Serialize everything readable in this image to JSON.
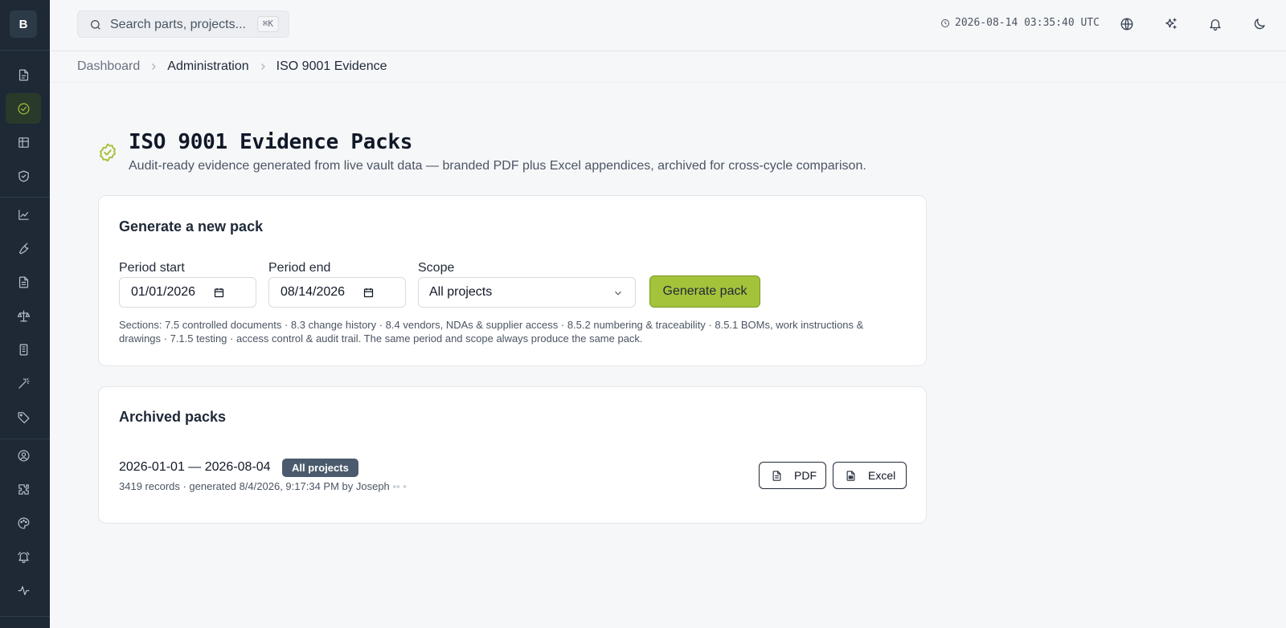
{
  "app": {
    "brand_letter": "B"
  },
  "topbar": {
    "search_placeholder": "Search parts, projects...",
    "search_shortcut": "⌘K",
    "clock": "2026-08-14 03:35:40 UTC"
  },
  "breadcrumb": [
    "Dashboard",
    "Administration",
    "ISO 9001 Evidence"
  ],
  "page": {
    "title": "ISO 9001 Evidence Packs",
    "subtitle": "Audit-ready evidence generated from live vault data — branded PDF plus Excel appendices, archived for cross-cycle comparison."
  },
  "generate": {
    "title": "Generate a new pack",
    "period_start_label": "Period start",
    "period_start_value": "01/01/2026",
    "period_end_label": "Period end",
    "period_end_value": "08/14/2026",
    "scope_label": "Scope",
    "scope_value": "All projects",
    "button": "Generate pack",
    "sections_line1": "Sections: 7.5 controlled documents · 8.3 change history · 8.4 vendors, NDAs & supplier access · 8.5.2 numbering & traceability · 8.5.1 BOMs, work instructions &",
    "sections_line2": "drawings · 7.1.5 testing · access control & audit trail. The same period and scope always produce the same pack."
  },
  "archived": {
    "title": "Archived packs",
    "items": [
      {
        "range": "2026-01-01 — 2026-08-04",
        "scope_badge": "All projects",
        "meta": "3419 records · generated 8/4/2026, 9:17:34 PM by Joseph",
        "pdf_label": "PDF",
        "excel_label": "Excel"
      }
    ]
  },
  "colors": {
    "sidebar_bg": "#1e2935",
    "accent": "#a4c23a",
    "badge_bg": "#4b5b6d"
  },
  "icons": {
    "sidebar": [
      "document-icon",
      "check-circle-icon",
      "table-icon",
      "shield-check-icon",
      "chart-icon",
      "wrench-icon",
      "file-text-icon",
      "scale-icon",
      "building-icon",
      "magic-wand-icon",
      "tag-icon",
      "user-circle-icon",
      "puzzle-icon",
      "palette-icon",
      "bell-ring-icon",
      "activity-icon"
    ],
    "topbar": [
      "globe-icon",
      "sparkles-icon",
      "bell-icon",
      "moon-icon"
    ]
  }
}
